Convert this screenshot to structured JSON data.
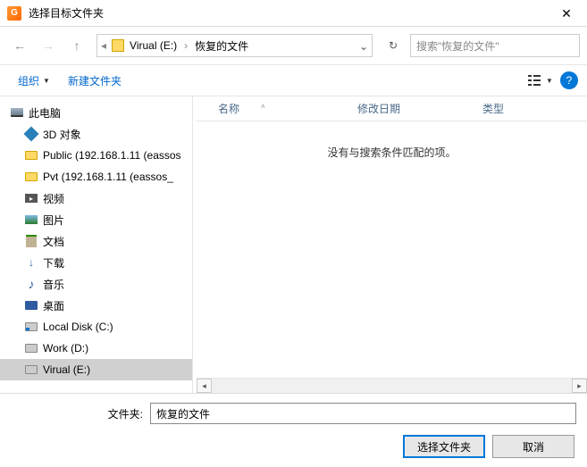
{
  "title": "选择目标文件夹",
  "breadcrumb": {
    "drive": "Virual (E:)",
    "folder": "恢复的文件"
  },
  "search": {
    "placeholder": "搜索\"恢复的文件\""
  },
  "toolbar": {
    "organize": "组织",
    "new_folder": "新建文件夹"
  },
  "sidebar": {
    "root": "此电脑",
    "items": [
      {
        "label": "3D 对象",
        "icon": "3d"
      },
      {
        "label": "Public (192.168.1.11 (eassos",
        "icon": "folder"
      },
      {
        "label": "Pvt (192.168.1.11 (eassos_",
        "icon": "folder"
      },
      {
        "label": "视频",
        "icon": "video"
      },
      {
        "label": "图片",
        "icon": "pic"
      },
      {
        "label": "文档",
        "icon": "doc"
      },
      {
        "label": "下载",
        "icon": "dl"
      },
      {
        "label": "音乐",
        "icon": "music"
      },
      {
        "label": "桌面",
        "icon": "desktop"
      },
      {
        "label": "Local Disk (C:)",
        "icon": "disk-c"
      },
      {
        "label": "Work (D:)",
        "icon": "disk"
      },
      {
        "label": "Virual (E:)",
        "icon": "disk",
        "selected": true
      }
    ]
  },
  "columns": {
    "name": "名称",
    "date": "修改日期",
    "type": "类型"
  },
  "empty_message": "没有与搜索条件匹配的项。",
  "folder_label": "文件夹:",
  "folder_value": "恢复的文件",
  "buttons": {
    "select": "选择文件夹",
    "cancel": "取消"
  }
}
